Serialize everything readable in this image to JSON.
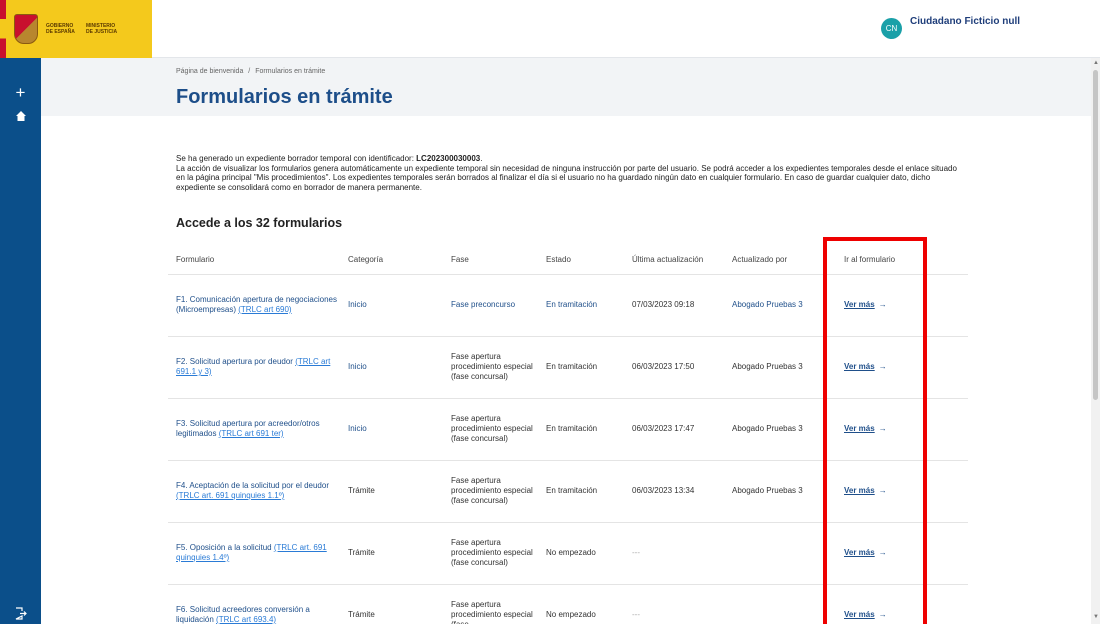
{
  "header": {
    "logo_gov_line1": "GOBIERNO",
    "logo_gov_line2": "DE ESPAÑA",
    "logo_min_line1": "MINISTERIO",
    "logo_min_line2": "DE JUSTICIA",
    "user_initials": "CN",
    "user_name": "Ciudadano Ficticio null"
  },
  "nav": {
    "add_icon": "plus-icon",
    "home_icon": "home-icon",
    "logout_icon": "logout-icon"
  },
  "breadcrumb": {
    "home": "Página de bienvenida",
    "separator": "/",
    "current": "Formularios en trámite"
  },
  "page_title": "Formularios en trámite",
  "info": {
    "line1_prefix": "Se ha generado un expediente borrador temporal con identificador: ",
    "identifier": "LC202300030003",
    "line1_suffix": ".",
    "paragraph": "La acción de visualizar los formularios genera automáticamente un expediente temporal sin necesidad de ninguna instrucción por parte del usuario. Se podrá acceder a los expedientes temporales desde el enlace situado en la página principal \"Mis procedimientos\". Los expedientes temporales serán borrados al finalizar el día si el usuario no ha guardado ningún dato en cualquier formulario. En caso de guardar cualquier dato, dicho expediente se consolidará como en borrador de manera permanente."
  },
  "section_title": "Accede a los 32 formularios",
  "table": {
    "headers": [
      "Formulario",
      "Categoría",
      "Fase",
      "Estado",
      "Última actualización",
      "Actualizado por",
      "Ir al formulario"
    ],
    "rows": [
      {
        "form": "F1. Comunicación apertura de negociaciones (Microempresas) ",
        "ref": "(TRLC art 690)",
        "category": "Inicio",
        "phase": "Fase preconcurso",
        "status": "En tramitación",
        "updated": "07/03/2023 09:18",
        "by": "Abogado Pruebas 3",
        "link": "Ver más"
      },
      {
        "form": "F2. Solicitud apertura por deudor ",
        "ref": "(TRLC art 691.1 y 3)",
        "category": "Inicio",
        "phase": "Fase apertura procedimiento especial (fase concursal)",
        "status": "En tramitación",
        "updated": "06/03/2023 17:50",
        "by": "Abogado Pruebas 3",
        "link": "Ver más"
      },
      {
        "form": "F3. Solicitud apertura por acreedor/otros legitimados ",
        "ref": "(TRLC art 691 ter)",
        "category": "Inicio",
        "phase": "Fase apertura procedimiento especial (fase concursal)",
        "status": "En tramitación",
        "updated": "06/03/2023 17:47",
        "by": "Abogado Pruebas 3",
        "link": "Ver más"
      },
      {
        "form": "F4. Aceptación de la solicitud por el deudor ",
        "ref": "(TRLC art. 691 quinquies 1.1º)",
        "category": "Trámite",
        "phase": "Fase apertura procedimiento especial (fase concursal)",
        "status": "En tramitación",
        "updated": "06/03/2023 13:34",
        "by": "Abogado Pruebas 3",
        "link": "Ver más"
      },
      {
        "form": "F5. Oposición a la solicitud ",
        "ref": "(TRLC art. 691 quinquies 1.4º)",
        "category": "Trámite",
        "phase": "Fase apertura procedimiento especial (fase concursal)",
        "status": "No empezado",
        "updated": "---",
        "by": "",
        "link": "Ver más"
      },
      {
        "form": "F6. Solicitud acreedores conversión a liquidación ",
        "ref": "(TRLC art 693.4)",
        "category": "Trámite",
        "phase": "Fase apertura procedimiento especial (fase",
        "status": "No empezado",
        "updated": "---",
        "by": "",
        "link": "Ver más"
      }
    ]
  },
  "colors": {
    "brand_blue": "#0b4f8a",
    "title_blue": "#1d4e89",
    "highlight": "#ee0000",
    "logo_yellow": "#f4c91c"
  }
}
